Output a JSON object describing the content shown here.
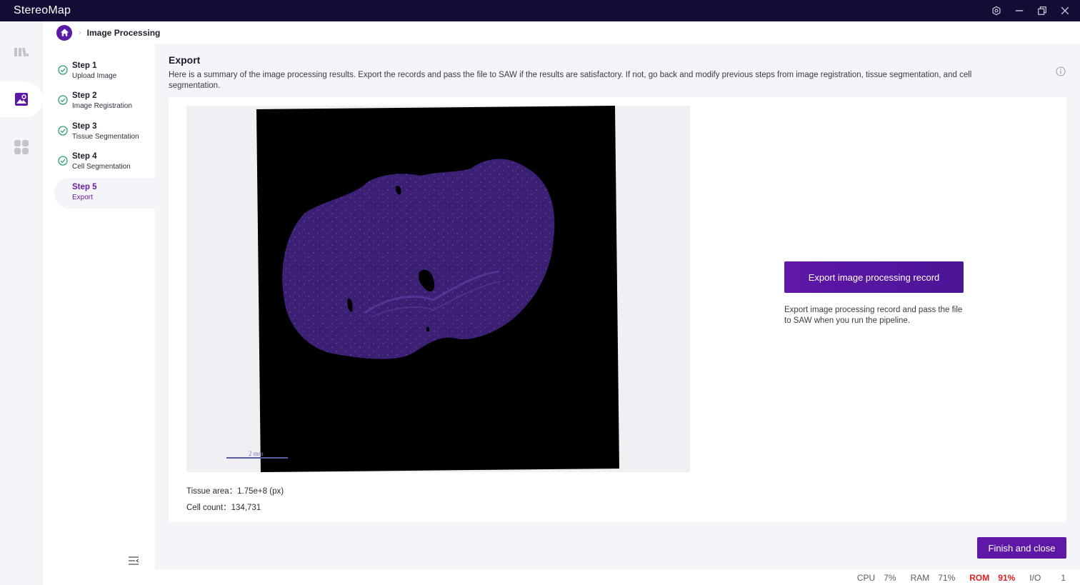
{
  "app": {
    "title": "StereoMap"
  },
  "window_controls": [
    "settings-icon",
    "minimize-icon",
    "restore-icon",
    "close-icon"
  ],
  "rail": {
    "items": [
      "gallery-icon",
      "image-processing-icon",
      "apps-icon"
    ],
    "active": "image-processing-icon"
  },
  "breadcrumb": {
    "current": "Image Processing"
  },
  "steps": [
    {
      "title": "Step 1",
      "subtitle": "Upload Image",
      "status": "done"
    },
    {
      "title": "Step 2",
      "subtitle": "Image Registration",
      "status": "done"
    },
    {
      "title": "Step 3",
      "subtitle": "Tissue Segmentation",
      "status": "done"
    },
    {
      "title": "Step 4",
      "subtitle": "Cell Segmentation",
      "status": "done"
    },
    {
      "title": "Step 5",
      "subtitle": "Export",
      "status": "active"
    }
  ],
  "content": {
    "title": "Export",
    "description": "Here is a summary of the image processing results. Export the records and pass the file to SAW if the results are satisfactory. If not, go back and modify previous steps from image registration, tissue segmentation, and cell segmentation."
  },
  "preview": {
    "scale_label": "2 mm"
  },
  "stats": {
    "tissue_area_label": "Tissue area：",
    "tissue_area_value": "1.75e+8 (px)",
    "cell_count_label": "Cell count：",
    "cell_count_value": "134,731"
  },
  "export": {
    "button_label": "Export image processing record",
    "description": "Export image processing record and pass the file to SAW when you run the pipeline."
  },
  "footer": {
    "finish_label": "Finish and close"
  },
  "status": {
    "cpu_label": "CPU",
    "cpu_value": "7%",
    "ram_label": "RAM",
    "ram_value": "71%",
    "rom_label": "ROM",
    "rom_value": "91%",
    "io_label": "I/O",
    "io_value": "1"
  },
  "colors": {
    "accent": "#5e17a6",
    "titlebar": "#150c35",
    "alert": "#e02020",
    "tissue": "#3a1f73"
  }
}
